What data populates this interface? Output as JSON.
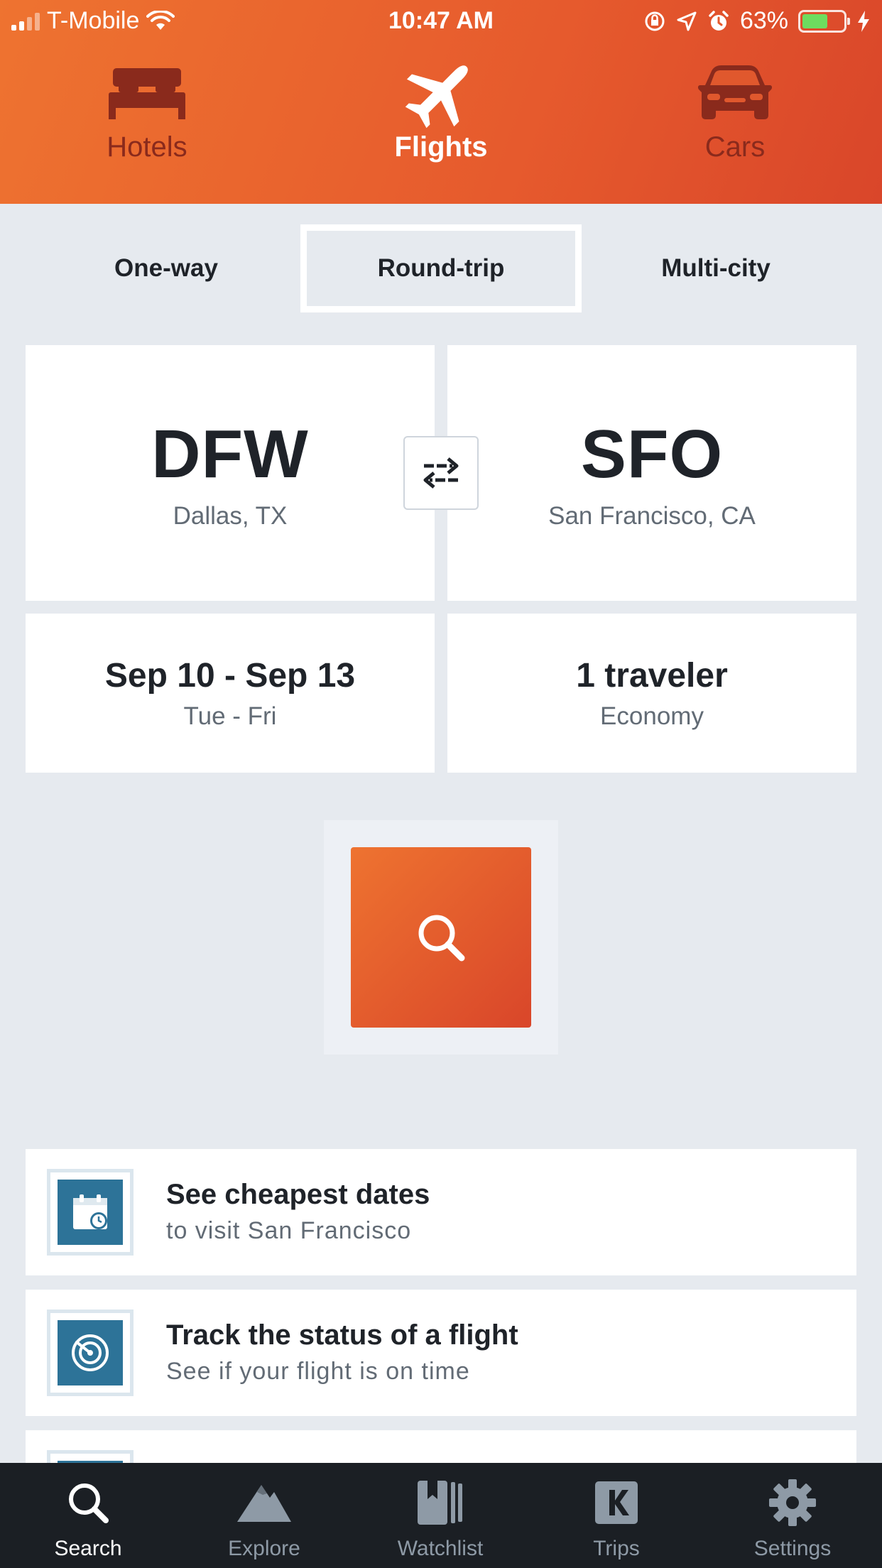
{
  "status_bar": {
    "carrier": "T-Mobile",
    "time": "10:47 AM",
    "battery": "63%",
    "battery_level": 0.63
  },
  "verticals": {
    "hotels": "Hotels",
    "flights": "Flights",
    "cars": "Cars",
    "active": "flights"
  },
  "trip_types": {
    "one_way": "One-way",
    "round_trip": "Round-trip",
    "multi_city": "Multi-city",
    "selected": "round_trip"
  },
  "origin": {
    "code": "DFW",
    "city": "Dallas, TX"
  },
  "destination": {
    "code": "SFO",
    "city": "San Francisco, CA"
  },
  "dates": {
    "range": "Sep 10 - Sep 13",
    "days": "Tue - Fri"
  },
  "travelers": {
    "count": "1 traveler",
    "cabin": "Economy"
  },
  "promos": [
    {
      "title": "See cheapest dates",
      "subtitle": "to visit San Francisco",
      "icon": "calendar-clock-icon"
    },
    {
      "title": "Track the status of a flight",
      "subtitle": "See if your flight is on time",
      "icon": "radar-icon"
    }
  ],
  "bottom_nav": {
    "search": "Search",
    "explore": "Explore",
    "watchlist": "Watchlist",
    "trips": "Trips",
    "settings": "Settings",
    "active": "search"
  },
  "colors": {
    "brand_orange": "#ee7330",
    "brand_red": "#d9462a",
    "promo_icon": "#2d7398",
    "nav_bg": "#1b1f24"
  }
}
